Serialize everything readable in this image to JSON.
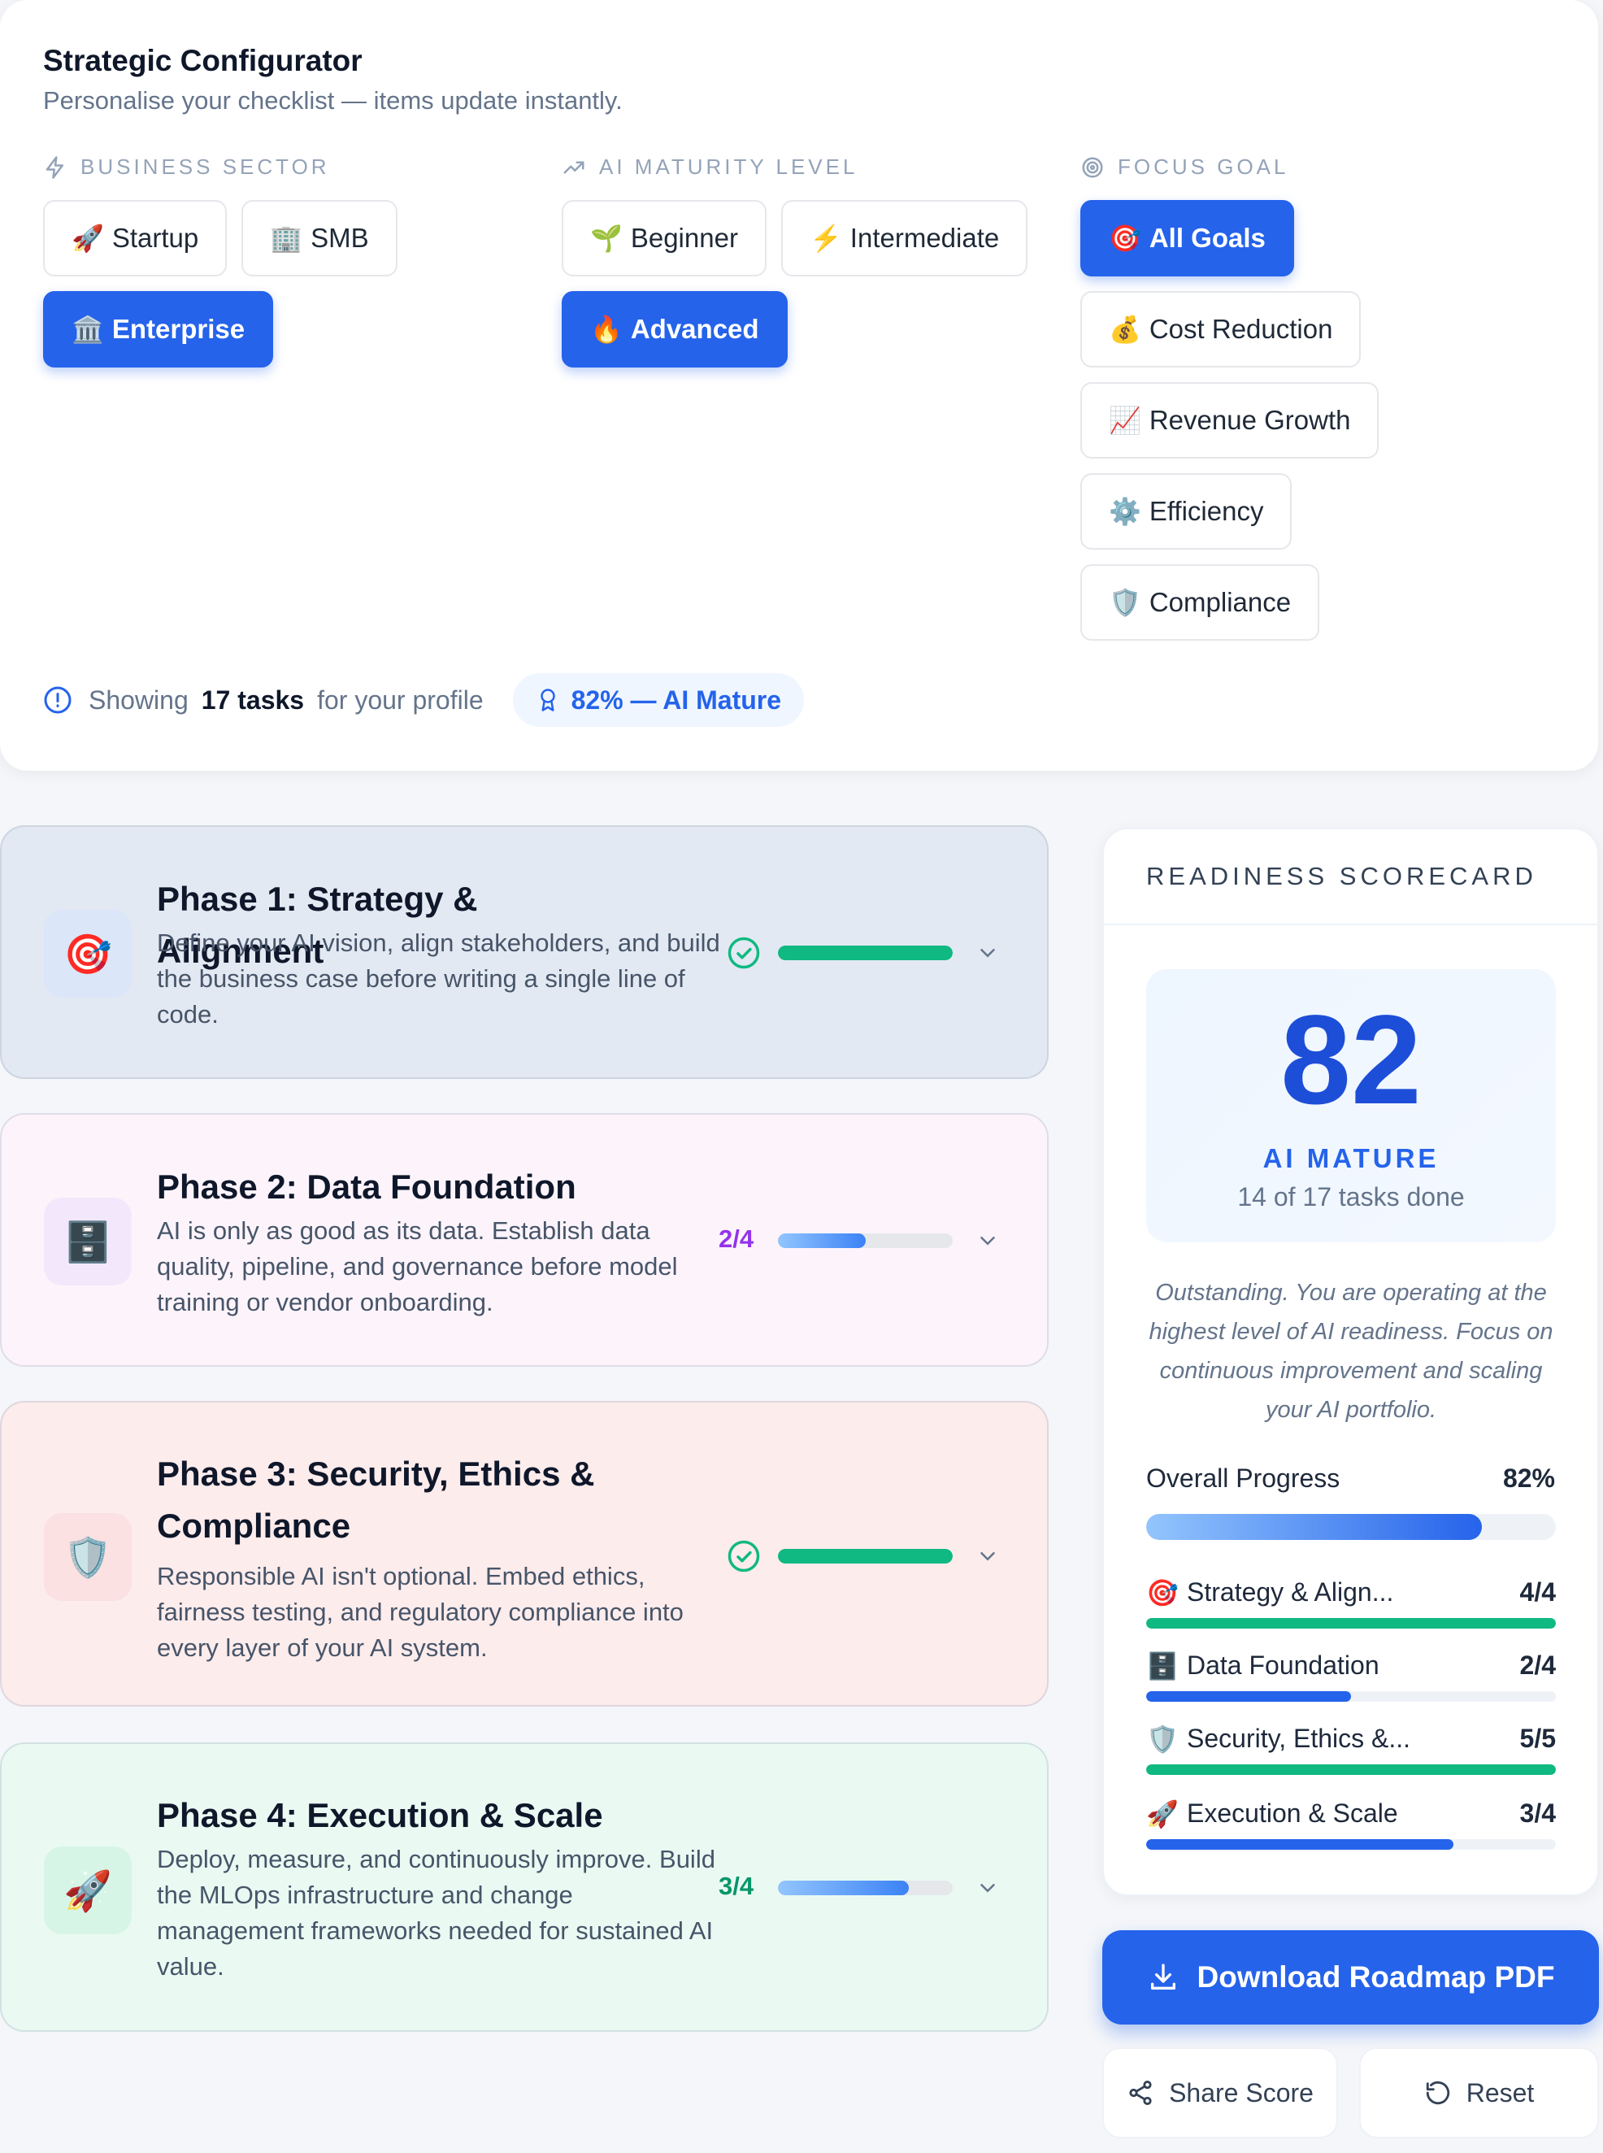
{
  "configurator": {
    "title": "Strategic Configurator",
    "subtitle": "Personalise your checklist — items update instantly.",
    "sector": {
      "label": "BUSINESS SECTOR",
      "options": [
        {
          "emoji": "🚀",
          "label": "Startup",
          "active": false
        },
        {
          "emoji": "🏢",
          "label": "SMB",
          "active": false
        },
        {
          "emoji": "🏛️",
          "label": "Enterprise",
          "active": true
        }
      ]
    },
    "maturity": {
      "label": "AI MATURITY LEVEL",
      "options": [
        {
          "emoji": "🌱",
          "label": "Beginner",
          "active": false
        },
        {
          "emoji": "⚡",
          "label": "Intermediate",
          "active": false
        },
        {
          "emoji": "🔥",
          "label": "Advanced",
          "active": true
        }
      ]
    },
    "goal": {
      "label": "FOCUS GOAL",
      "options": [
        {
          "emoji": "🎯",
          "label": "All Goals",
          "active": true
        },
        {
          "emoji": "💰",
          "label": "Cost Reduction",
          "active": false
        },
        {
          "emoji": "📈",
          "label": "Revenue Growth",
          "active": false
        },
        {
          "emoji": "⚙️",
          "label": "Efficiency",
          "active": false
        },
        {
          "emoji": "🛡️",
          "label": "Compliance",
          "active": false
        }
      ]
    },
    "footer": {
      "showing_prefix": "Showing",
      "task_count": "17 tasks",
      "showing_suffix": "for your profile",
      "maturity_pill": "82% — AI Mature"
    }
  },
  "phases": [
    {
      "emoji": "🎯",
      "title": "Phase 1: Strategy & Alignment",
      "description": "Define your AI vision, align stakeholders, and build the business case before writing a single line of code.",
      "status": "",
      "complete": true,
      "progress": 1.0
    },
    {
      "emoji": "🗄️",
      "title": "Phase 2: Data Foundation",
      "description": "AI is only as good as its data. Establish data quality, pipeline, and governance before model training or vendor onboarding.",
      "status": "2/4",
      "complete": false,
      "progress": 0.5
    },
    {
      "emoji": "🛡️",
      "title": "Phase 3: Security, Ethics & Compliance",
      "description": "Responsible AI isn't optional. Embed ethics, fairness testing, and regulatory compliance into every layer of your AI system.",
      "status": "",
      "complete": true,
      "progress": 1.0
    },
    {
      "emoji": "🚀",
      "title": "Phase 4: Execution & Scale",
      "description": "Deploy, measure, and continuously improve. Build the MLOps infrastructure and change management frameworks needed for sustained AI value.",
      "status": "3/4",
      "complete": false,
      "progress": 0.75
    }
  ],
  "scorecard": {
    "heading": "READINESS SCORECARD",
    "score": "82",
    "level": "AI MATURE",
    "tasks_done": "14 of 17 tasks done",
    "message": "Outstanding. You are operating at the highest level of AI readiness. Focus on continuous improvement and scaling your AI portfolio.",
    "overall_label": "Overall Progress",
    "overall_value": "82%",
    "overall_progress": 0.82,
    "rows": [
      {
        "emoji": "🎯",
        "name": "Strategy & Align...",
        "value": "4/4",
        "progress": 1.0,
        "color": "#10b981"
      },
      {
        "emoji": "🗄️",
        "name": "Data Foundation",
        "value": "2/4",
        "progress": 0.5,
        "color": "#2563eb"
      },
      {
        "emoji": "🛡️",
        "name": "Security, Ethics &...",
        "value": "5/5",
        "progress": 1.0,
        "color": "#10b981"
      },
      {
        "emoji": "🚀",
        "name": "Execution & Scale",
        "value": "3/4",
        "progress": 0.75,
        "color": "#2563eb"
      }
    ]
  },
  "actions": {
    "download": "Download Roadmap PDF",
    "share": "Share Score",
    "reset": "Reset"
  },
  "colors": {
    "accent": "#2563eb",
    "success": "#10b981",
    "phase2_status": "#9333ea",
    "phase4_status": "#059669"
  }
}
